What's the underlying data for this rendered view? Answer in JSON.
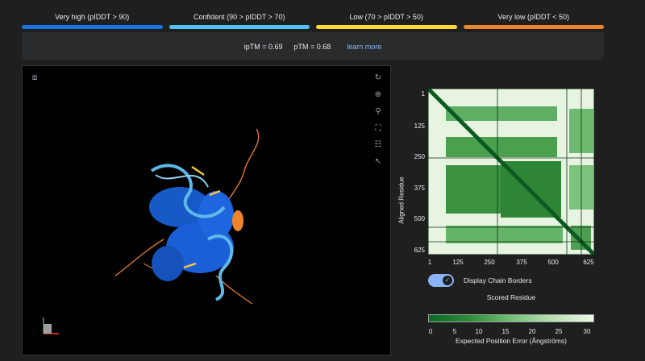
{
  "legend": [
    {
      "label": "Very high (pIDDT > 90)",
      "color": "#1a73e8"
    },
    {
      "label": "Confident (90 > pIDDT > 70)",
      "color": "#4fc3f7"
    },
    {
      "label": "Low (70 > pIDDT > 50)",
      "color": "#fdd835"
    },
    {
      "label": "Very low (pIDDT < 50)",
      "color": "#f0842c"
    }
  ],
  "metrics": {
    "iptm": "ipTM = 0.69",
    "ptm": "pTM = 0.68",
    "learn_more": "learn more"
  },
  "viewer_tools": {
    "camera": "camera-icon",
    "reset": "reset-view-icon",
    "focus": "focus-icon",
    "measure": "measure-icon",
    "expand": "expand-icon",
    "settings": "settings-sliders-icon",
    "select": "pointer-icon"
  },
  "pae": {
    "y_label": "Aligned Residue",
    "y_ticks": [
      "1",
      "125",
      "250",
      "375",
      "500",
      "625"
    ],
    "x_ticks": [
      "1",
      "125",
      "250",
      "375",
      "500",
      "625"
    ],
    "toggle_label": "Display Chain Borders",
    "toggle_on": true,
    "x_label": "Scored Residue",
    "colorbar_ticks": [
      "0",
      "5",
      "10",
      "15",
      "20",
      "25",
      "30"
    ],
    "colorbar_label": "Expected Position Error (Ångströms)"
  }
}
